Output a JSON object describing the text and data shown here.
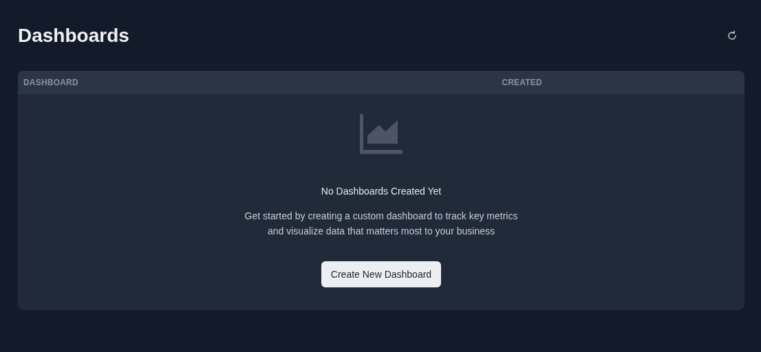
{
  "page": {
    "title": "Dashboards"
  },
  "table": {
    "columns": [
      "DASHBOARD",
      "CREATED"
    ],
    "empty_state": {
      "title": "No Dashboards Created Yet",
      "description_lines": [
        "Get started by creating a custom dashboard to track key metrics",
        "and visualize data that matters most to your business"
      ],
      "button": "Create New Dashboard"
    }
  }
}
